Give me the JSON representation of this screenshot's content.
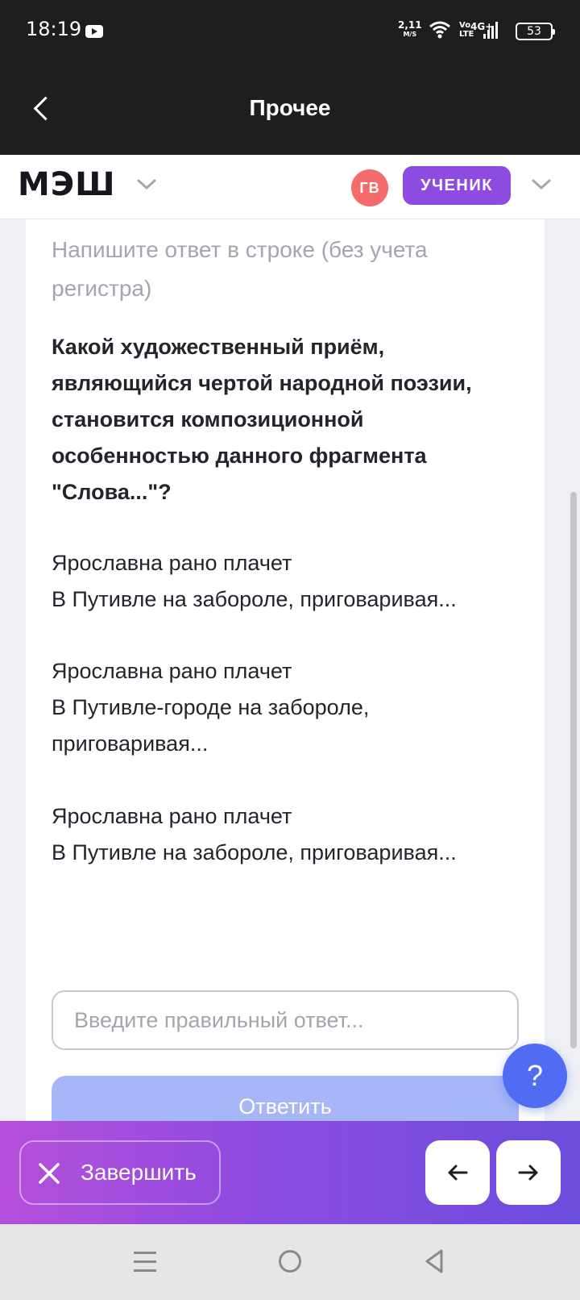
{
  "status_bar": {
    "time": "18:19",
    "net_speed_value": "2,11",
    "net_speed_unit": "M/S",
    "volte_1": "Vo",
    "volte_2": "LTE",
    "network": "4G+",
    "battery": "53",
    "icons": [
      "youtube-icon",
      "wifi-icon",
      "signal-icon",
      "battery-icon"
    ]
  },
  "title_bar": {
    "title": "Прочее",
    "back_icon": "chevron-left-icon"
  },
  "header": {
    "logo": "МЭШ",
    "avatar_initials": "ГВ",
    "role": "УЧЕНИК",
    "colors": {
      "avatar": "#f36b6b",
      "role_badge": "#8d4be0"
    }
  },
  "content": {
    "hint": "Напишите ответ в строке (без учета регистра)",
    "question": "Какой художественный приём, являющийся чертой народной поэзии, становится композиционной особенностью данного фрагмента \"Слова...\"?",
    "stanzas": [
      {
        "line1": "Ярославна рано плачет",
        "line2": "В Путивле на забороле, приговаривая..."
      },
      {
        "line1": "Ярославна рано плачет",
        "line2": "В Путивле-городе на забороле, приговаривая..."
      },
      {
        "line1": "Ярославна рано плачет",
        "line2": "В Путивле на забороле, приговаривая..."
      }
    ],
    "answer_placeholder": "Введите правильный ответ...",
    "answer_value": "",
    "submit_label": "Ответить",
    "help_label": "?"
  },
  "action_bar": {
    "finish_label": "Завершить",
    "prev_icon": "arrow-left-icon",
    "next_icon": "arrow-right-icon",
    "gradient": [
      "#b64fdb",
      "#8d4be0",
      "#6b4ddc"
    ]
  },
  "system_nav": {
    "icons": [
      "menu-icon",
      "home-icon",
      "back-icon"
    ]
  }
}
